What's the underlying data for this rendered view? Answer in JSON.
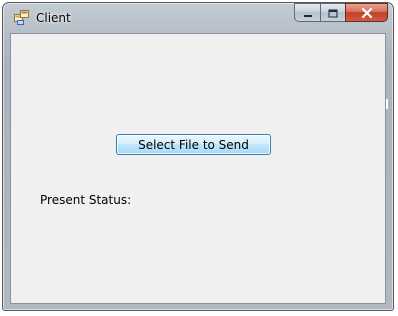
{
  "window": {
    "title": "Client",
    "icon": "app-window-icon"
  },
  "caption_buttons": {
    "minimize_icon": "minimize-icon",
    "maximize_icon": "maximize-icon",
    "close_icon": "close-icon"
  },
  "main": {
    "send_button_label": "Select File to Send",
    "status_label": "Present Status:"
  },
  "colors": {
    "close_button": "#c7452c",
    "button_border": "#3c7fb1",
    "client_background": "#f0f0f0"
  }
}
